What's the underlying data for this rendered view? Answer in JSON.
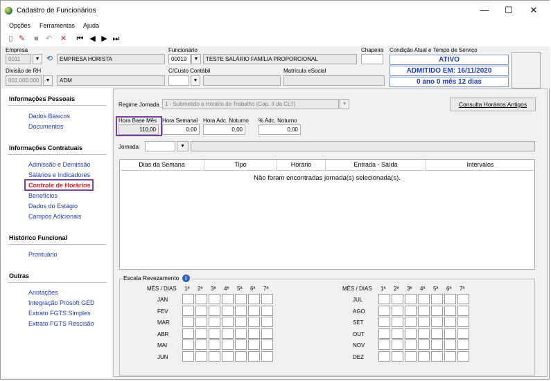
{
  "window": {
    "title": "Cadastro de Funcionários",
    "minimize": "—",
    "maximize": "☐",
    "close": "✕"
  },
  "menu": {
    "opcoes": "Opções",
    "ferramentas": "Ferramentas",
    "ajuda": "Ajuda"
  },
  "header": {
    "empresa_label": "Empresa",
    "empresa_code": "0011",
    "empresa_name": "EMPRESA HORISTA",
    "funcionario_label": "Funcionário",
    "funcionario_code": "00019",
    "funcionario_name": "TESTE SALÁRIO FAMÍLIA PROPORCIONAL",
    "chapeira_label": "Chapeira",
    "chapeira_value": "",
    "condicao_label": "Condição Atual e Tempo de Serviço",
    "status": "ATIVO",
    "admitido": "ADMITIDO EM: 16/11/2020",
    "tempo": "0 ano 0 mês 12 dias",
    "divisao_label": "Divisão de RH",
    "divisao_code": "001.000.000",
    "divisao_name": "ADM",
    "custo_label": "C/Custo Contábil",
    "custo_code": "",
    "custo_name": "",
    "matricula_label": "Matrícula eSocial",
    "matricula_value": ""
  },
  "sidebar": {
    "sections": [
      {
        "title": "Informações Pessoais",
        "items": [
          "Dados Básicos",
          "Documentos"
        ]
      },
      {
        "title": "Informações Contratuais",
        "items": [
          "Admissão e Demissão",
          "Salários e Indicadores",
          "Controle de Horários",
          "Benefícios",
          "Dados do Estágio",
          "Campos Adicionais"
        ]
      },
      {
        "title": "Histórico Funcional",
        "items": [
          "Prontuário"
        ]
      },
      {
        "title": "Outras",
        "items": [
          "Anotações",
          "Integração Prosoft GED",
          "Extrato FGTS Simples",
          "Extrato FGTS Rescisão"
        ]
      }
    ],
    "active_item": "Controle de Horários",
    "active_color": "#e0201c",
    "link_color": "#1c39b5"
  },
  "main": {
    "regime_label": "Regime Jornada",
    "regime_value": "1 - Submetido a Horário de Trabalho (Cap. II da CLT)",
    "consulta_button": "Consulta Horários Antigos",
    "hora_base_label": "Hora Base Mês",
    "hora_base_value": "110,00",
    "hora_semanal_label": "Hora Semanal",
    "hora_semanal_value": "0,00",
    "hora_adc_label": "Hora Adc. Noturno",
    "hora_adc_value": "0,00",
    "perc_adc_label": "% Adc. Noturno",
    "perc_adc_value": "0,00",
    "jornada_label": "Jornada:",
    "jornada_value": "",
    "grid_columns": [
      "Dias da Semana",
      "Tipo",
      "Horário",
      "Entrada - Saída",
      "Intervalos"
    ],
    "grid_empty": "Não foram encontradas jornada(s) selecionada(s).",
    "escala_label": "Escala Revezamento",
    "mes_dias": "MÊS / DIAS",
    "days": [
      "1ª",
      "2ª",
      "3ª",
      "4ª",
      "5ª",
      "6ª",
      "7ª"
    ],
    "months_left": [
      "JAN",
      "FEV",
      "MAR",
      "ABR",
      "MAI",
      "JUN"
    ],
    "months_right": [
      "JUL",
      "AGO",
      "SET",
      "OUT",
      "NOV",
      "DEZ"
    ],
    "highlight_color": "#7b3f9e"
  }
}
